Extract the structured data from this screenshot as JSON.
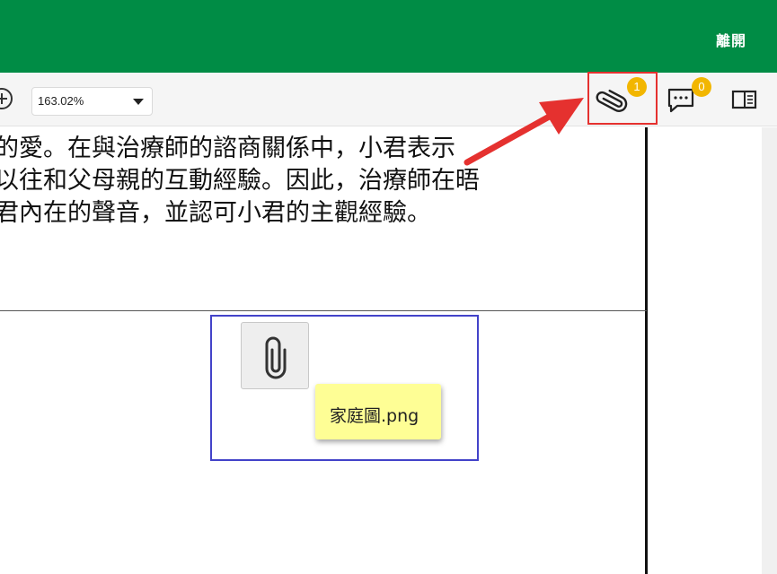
{
  "header": {
    "leave_label": "離開",
    "bg_color": "#008c45"
  },
  "toolbar": {
    "zoom_value": "163.02%",
    "attachments_badge": "1",
    "comments_badge": "0",
    "icons": [
      "zoom-in-icon",
      "chevron-down-icon",
      "paperclip-icon",
      "comment-icon",
      "sidebar-toggle-icon"
    ]
  },
  "document": {
    "lines": [
      "的愛。在與治療師的諮商關係中，小君表示",
      "以往和父母親的互動經驗。因此，治療師在晤",
      "君內在的聲音，並認可小君的主觀經驗。"
    ]
  },
  "attachment": {
    "file_name": "家庭圖.png"
  },
  "colors": {
    "badge": "#f2b600",
    "highlight": "#e5312f",
    "annotation_border": "#4343c9",
    "file_tag_bg": "#fefe95"
  }
}
